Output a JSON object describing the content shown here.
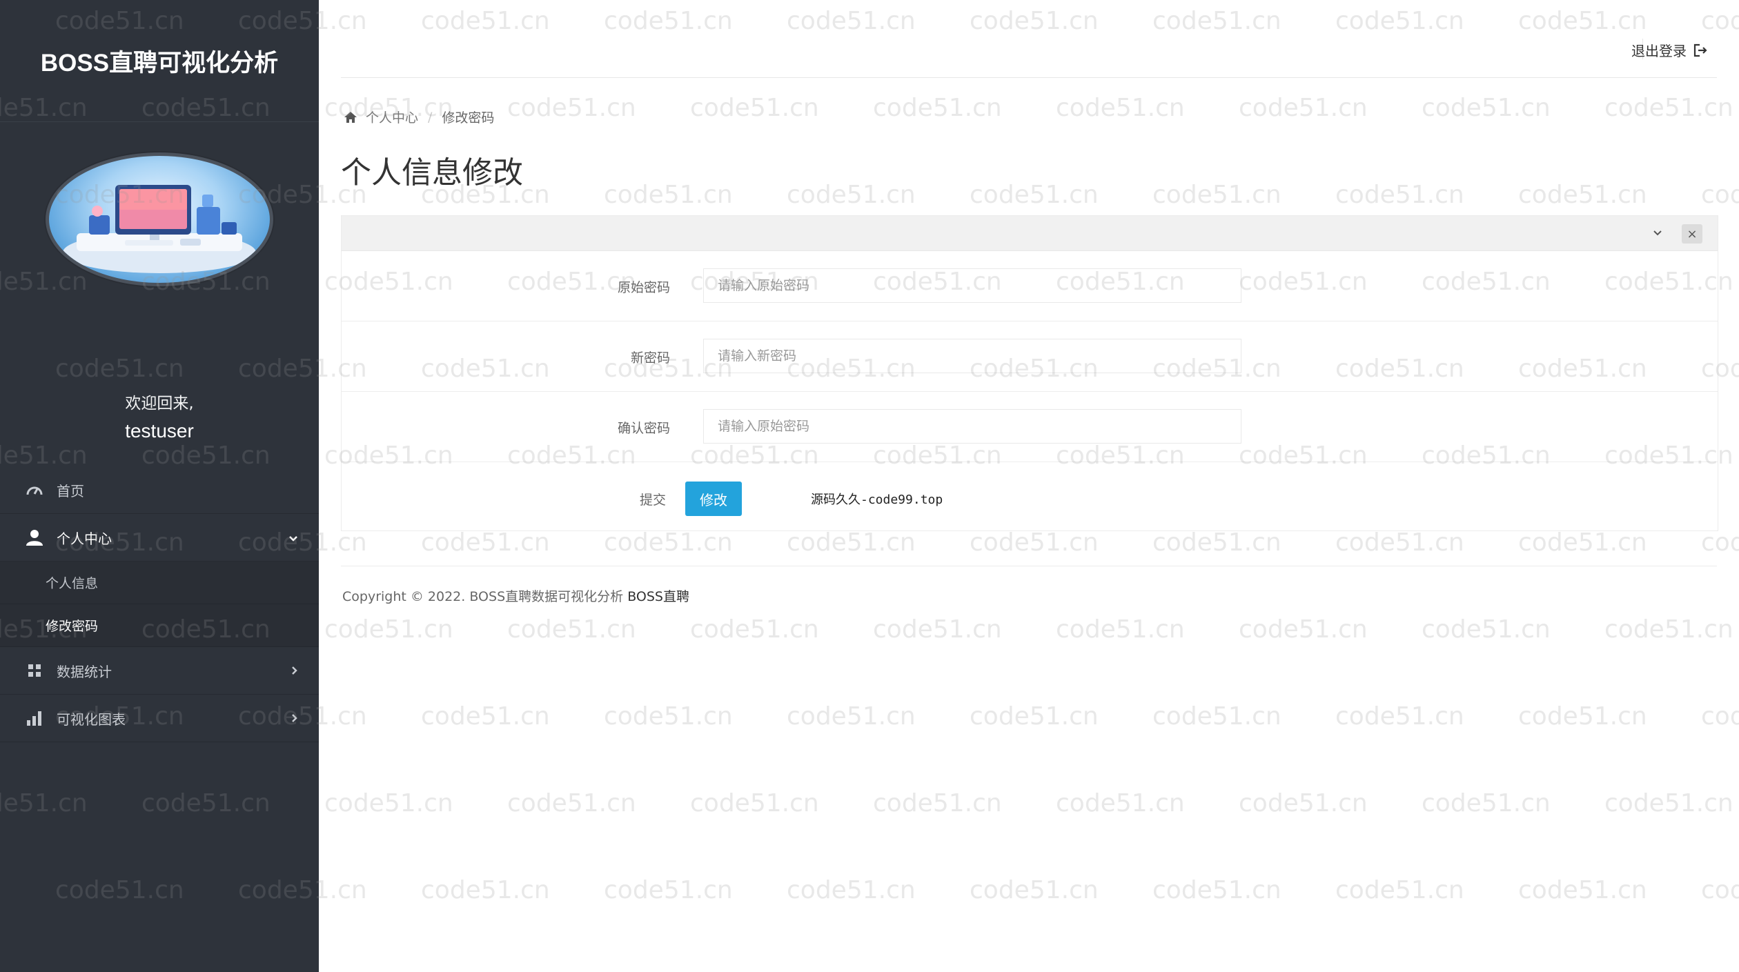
{
  "app": {
    "title": "BOSS直聘可视化分析"
  },
  "user": {
    "welcome": "欢迎回来,",
    "name": "testuser"
  },
  "sidebar": {
    "items": [
      {
        "label": "首页",
        "icon": "dashboard-gauge-icon"
      },
      {
        "label": "个人中心",
        "icon": "user-icon",
        "expanded": true,
        "children": [
          {
            "label": "个人信息"
          },
          {
            "label": "修改密码",
            "current": true
          }
        ]
      },
      {
        "label": "数据统计",
        "icon": "grid-icon"
      },
      {
        "label": "可视化图表",
        "icon": "bar-chart-icon"
      }
    ]
  },
  "header": {
    "logout_label": "退出登录"
  },
  "breadcrumb": {
    "root": "个人中心",
    "sep": "/",
    "current": "修改密码"
  },
  "page": {
    "title": "个人信息修改"
  },
  "form": {
    "old_password": {
      "label": "原始密码",
      "placeholder": "请输入原始密码"
    },
    "new_password": {
      "label": "新密码",
      "placeholder": "请输入新密码"
    },
    "confirm_password": {
      "label": "确认密码",
      "placeholder": "请输入原始密码"
    },
    "submit": {
      "label": "提交",
      "button": "修改"
    },
    "note": "源码久久-code99.top"
  },
  "footer": {
    "text": "Copyright © 2022. BOSS直聘数据可视化分析",
    "brand": "BOSS直聘"
  },
  "watermark": {
    "text": "code51.cn"
  },
  "colors": {
    "sidebar": "#2e333b",
    "primary_button": "#23a3dc"
  }
}
